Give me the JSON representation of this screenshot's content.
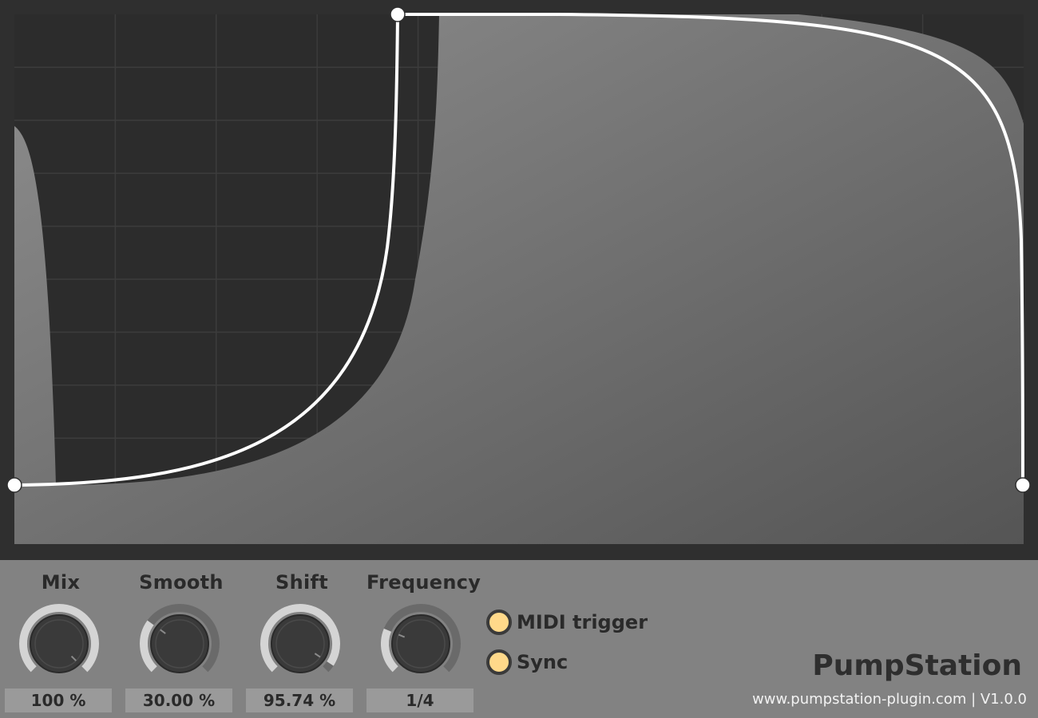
{
  "curve_editor": {
    "points": [
      {
        "name": "start-point",
        "phase": 0.0,
        "level": 0.0
      },
      {
        "name": "peak-point",
        "phase": 0.38,
        "level": 1.0
      },
      {
        "name": "end-point",
        "phase": 1.0,
        "level": 0.0
      }
    ],
    "colors": {
      "background": "#2f2f2f",
      "grid": "#3e3e3e",
      "fill_light": "#8a8a8a",
      "fill_dark": "#575757",
      "curve": "#ffffff"
    }
  },
  "knobs": [
    {
      "id": "mix",
      "label": "Mix",
      "value_text": "100 %",
      "value": 1.0
    },
    {
      "id": "smooth",
      "label": "Smooth",
      "value_text": "30.00 %",
      "value": 0.3
    },
    {
      "id": "shift",
      "label": "Shift",
      "value_text": "95.74 %",
      "value": 0.9574
    },
    {
      "id": "frequency",
      "label": "Frequency",
      "value_text": "1/4",
      "value": 0.25
    }
  ],
  "toggles": [
    {
      "id": "midi-trigger",
      "label": "MIDI trigger",
      "on": true
    },
    {
      "id": "sync",
      "label": "Sync",
      "on": true
    }
  ],
  "brand": {
    "name": "PumpStation",
    "footer": "www.pumpstation-plugin.com | V1.0.0"
  },
  "colors": {
    "panel": "#828282",
    "knob_arc_track": "#6a6a6a",
    "knob_arc_value": "#d4d4d4",
    "knob_body": "#3a3a3a",
    "toggle_led": "#ffd98a"
  }
}
